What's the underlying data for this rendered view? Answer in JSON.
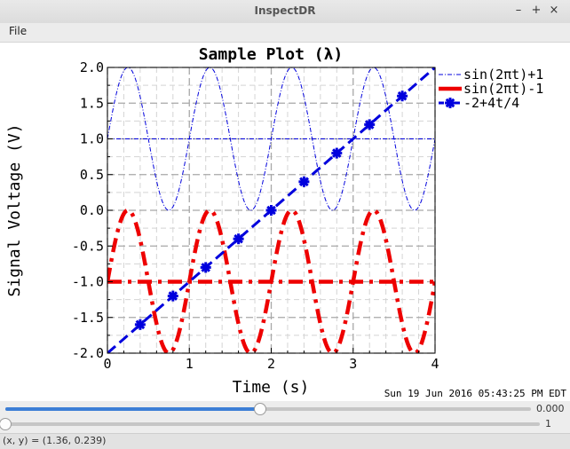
{
  "window": {
    "title": "InspectDR",
    "minimize_glyph": "–",
    "maximize_glyph": "+",
    "close_glyph": "×"
  },
  "menu": {
    "file_label": "File"
  },
  "plot": {
    "timestamp": "Sun 19 Jun 2016 05:43:25 PM EDT"
  },
  "chart_data": {
    "type": "line",
    "title": "Sample Plot (λ)",
    "xlabel": "Time (s)",
    "ylabel": "Signal Voltage (V)",
    "xlim": [
      0,
      4
    ],
    "ylim": [
      -2,
      2
    ],
    "xticks": [
      0,
      1,
      2,
      3,
      4
    ],
    "xtick_labels": [
      "0",
      "1",
      "2",
      "3",
      "4"
    ],
    "yticks": [
      -2,
      -1.5,
      -1,
      -0.5,
      0,
      0.5,
      1,
      1.5,
      2
    ],
    "ytick_labels": [
      "-2.0",
      "-1.5",
      "-1.0",
      "-0.5",
      "0.0",
      "0.5",
      "1.0",
      "1.5",
      "2.0"
    ],
    "grid": true,
    "legend_position": "right",
    "series": [
      {
        "name": "sin(2πt)+1",
        "formula": "sin(2πt)+1",
        "color": "#0000dd",
        "style": "dash-dot-thin",
        "reference_line": 1,
        "x_start": 0,
        "x_end": 4
      },
      {
        "name": "sin(2πt)-1",
        "formula": "sin(2πt)-1",
        "color": "#ee0000",
        "style": "dash-dot-thick",
        "reference_line": -1,
        "x_start": 0,
        "x_end": 4
      },
      {
        "name": "-2+4t/4",
        "formula": "-2+t",
        "color": "#0000dd",
        "style": "dashed-with-star-markers",
        "x": [
          0,
          4
        ],
        "y": [
          -2,
          2
        ],
        "marker_x": [
          0.4,
          0.8,
          1.2,
          1.6,
          2.0,
          2.4,
          2.8,
          3.2,
          3.6
        ],
        "marker_y": [
          -1.6,
          -1.2,
          -0.8,
          -0.4,
          0.0,
          0.4,
          0.8,
          1.2,
          1.6
        ]
      }
    ]
  },
  "sliders": [
    {
      "value_label": "0.000",
      "fraction": 0.485
    },
    {
      "value_label": "1",
      "fraction": 0.0
    }
  ],
  "status": {
    "text": "(x, y) = (1.36, 0.239)"
  }
}
